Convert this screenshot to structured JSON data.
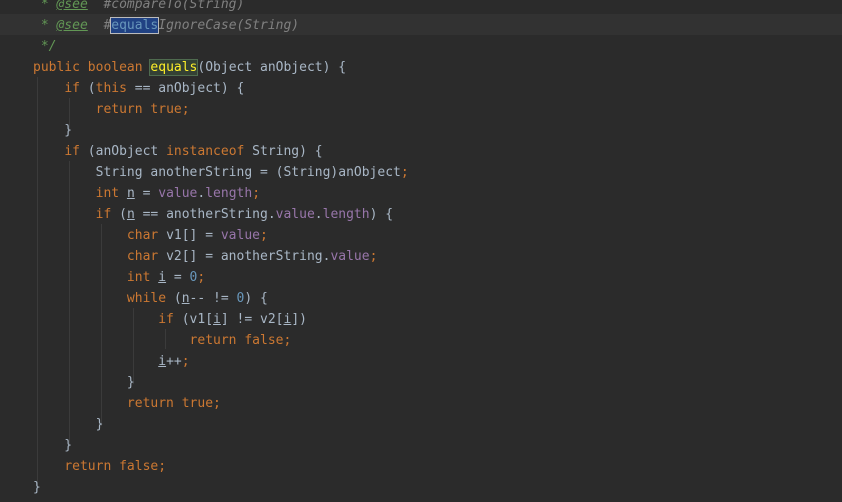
{
  "lines": [
    {
      "parts": [
        {
          "t": " * ",
          "c": "cm"
        },
        {
          "t": "@see",
          "c": "tag"
        },
        {
          "t": "  #compareTo(String)",
          "c": "ref"
        }
      ]
    },
    {
      "parts": [
        {
          "t": " * ",
          "c": "cm"
        },
        {
          "t": "@see",
          "c": "tag"
        },
        {
          "t": "  #",
          "c": "ref"
        },
        {
          "t": "equals",
          "c": "sel"
        },
        {
          "t": "IgnoreCase(String)",
          "c": "ref"
        }
      ]
    },
    {
      "parts": [
        {
          "t": " */",
          "c": "cm"
        }
      ]
    },
    {
      "parts": [
        {
          "t": "public ",
          "c": "kw"
        },
        {
          "t": "boolean ",
          "c": "kw"
        },
        {
          "t": "equals",
          "c": "hl-method"
        },
        {
          "t": "(Object anObject) {",
          "c": ""
        }
      ]
    },
    {
      "parts": [
        {
          "t": "    ",
          "c": ""
        },
        {
          "t": "if ",
          "c": "kw"
        },
        {
          "t": "(",
          "c": ""
        },
        {
          "t": "this ",
          "c": "kw"
        },
        {
          "t": "== anObject) {",
          "c": ""
        }
      ]
    },
    {
      "parts": [
        {
          "t": "        ",
          "c": ""
        },
        {
          "t": "return true",
          "c": "kw"
        },
        {
          "t": ";",
          "c": "kw"
        }
      ]
    },
    {
      "parts": [
        {
          "t": "    }",
          "c": ""
        }
      ]
    },
    {
      "parts": [
        {
          "t": "    ",
          "c": ""
        },
        {
          "t": "if ",
          "c": "kw"
        },
        {
          "t": "(anObject ",
          "c": ""
        },
        {
          "t": "instanceof ",
          "c": "kw"
        },
        {
          "t": "String) {",
          "c": ""
        }
      ]
    },
    {
      "parts": [
        {
          "t": "        String anotherString = (String)anObject",
          "c": ""
        },
        {
          "t": ";",
          "c": "kw"
        }
      ]
    },
    {
      "parts": [
        {
          "t": "        ",
          "c": ""
        },
        {
          "t": "int ",
          "c": "kw"
        },
        {
          "t": "n",
          "c": "ul"
        },
        {
          "t": " = ",
          "c": ""
        },
        {
          "t": "value",
          "c": "fld"
        },
        {
          "t": ".",
          "c": ""
        },
        {
          "t": "length",
          "c": "fld"
        },
        {
          "t": ";",
          "c": "kw"
        }
      ]
    },
    {
      "parts": [
        {
          "t": "        ",
          "c": ""
        },
        {
          "t": "if ",
          "c": "kw"
        },
        {
          "t": "(",
          "c": ""
        },
        {
          "t": "n",
          "c": "ul"
        },
        {
          "t": " == anotherString.",
          "c": ""
        },
        {
          "t": "value",
          "c": "fld"
        },
        {
          "t": ".",
          "c": ""
        },
        {
          "t": "length",
          "c": "fld"
        },
        {
          "t": ") {",
          "c": ""
        }
      ]
    },
    {
      "parts": [
        {
          "t": "            ",
          "c": ""
        },
        {
          "t": "char ",
          "c": "kw"
        },
        {
          "t": "v1[] = ",
          "c": ""
        },
        {
          "t": "value",
          "c": "fld"
        },
        {
          "t": ";",
          "c": "kw"
        }
      ]
    },
    {
      "parts": [
        {
          "t": "            ",
          "c": ""
        },
        {
          "t": "char ",
          "c": "kw"
        },
        {
          "t": "v2[] = anotherString.",
          "c": ""
        },
        {
          "t": "value",
          "c": "fld"
        },
        {
          "t": ";",
          "c": "kw"
        }
      ]
    },
    {
      "parts": [
        {
          "t": "            ",
          "c": ""
        },
        {
          "t": "int ",
          "c": "kw"
        },
        {
          "t": "i",
          "c": "ul"
        },
        {
          "t": " = ",
          "c": ""
        },
        {
          "t": "0",
          "c": "num"
        },
        {
          "t": ";",
          "c": "kw"
        }
      ]
    },
    {
      "parts": [
        {
          "t": "            ",
          "c": ""
        },
        {
          "t": "while ",
          "c": "kw"
        },
        {
          "t": "(",
          "c": ""
        },
        {
          "t": "n",
          "c": "ul"
        },
        {
          "t": "-- != ",
          "c": ""
        },
        {
          "t": "0",
          "c": "num"
        },
        {
          "t": ") {",
          "c": ""
        }
      ]
    },
    {
      "parts": [
        {
          "t": "                ",
          "c": ""
        },
        {
          "t": "if ",
          "c": "kw"
        },
        {
          "t": "(v1[",
          "c": ""
        },
        {
          "t": "i",
          "c": "ul"
        },
        {
          "t": "] != v2[",
          "c": ""
        },
        {
          "t": "i",
          "c": "ul"
        },
        {
          "t": "])",
          "c": ""
        }
      ]
    },
    {
      "parts": [
        {
          "t": "                    ",
          "c": ""
        },
        {
          "t": "return false",
          "c": "kw"
        },
        {
          "t": ";",
          "c": "kw"
        }
      ]
    },
    {
      "parts": [
        {
          "t": "                ",
          "c": ""
        },
        {
          "t": "i",
          "c": "ul"
        },
        {
          "t": "++",
          "c": ""
        },
        {
          "t": ";",
          "c": "kw"
        }
      ]
    },
    {
      "parts": [
        {
          "t": "            }",
          "c": ""
        }
      ]
    },
    {
      "parts": [
        {
          "t": "            ",
          "c": ""
        },
        {
          "t": "return true",
          "c": "kw"
        },
        {
          "t": ";",
          "c": "kw"
        }
      ]
    },
    {
      "parts": [
        {
          "t": "        }",
          "c": ""
        }
      ]
    },
    {
      "parts": [
        {
          "t": "    }",
          "c": ""
        }
      ]
    },
    {
      "parts": [
        {
          "t": "    ",
          "c": ""
        },
        {
          "t": "return false",
          "c": "kw"
        },
        {
          "t": ";",
          "c": "kw"
        }
      ]
    },
    {
      "parts": [
        {
          "t": "}",
          "c": ""
        }
      ]
    }
  ]
}
